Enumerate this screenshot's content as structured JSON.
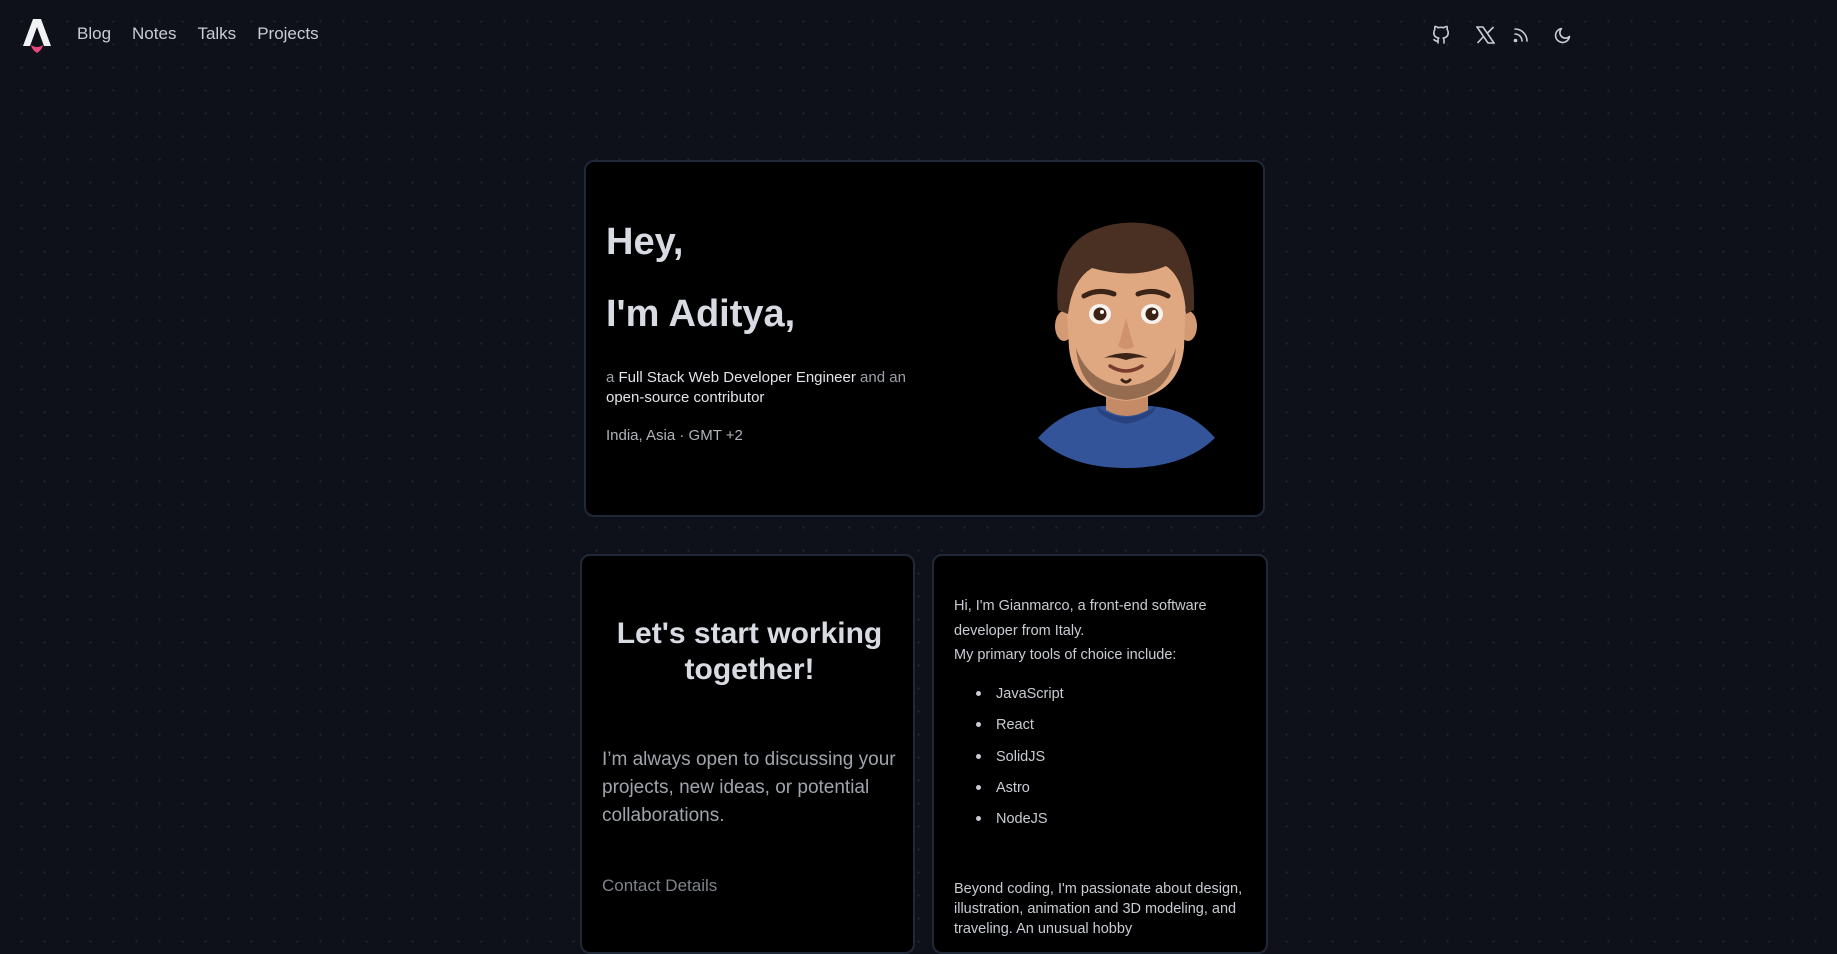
{
  "nav": {
    "links": [
      "Blog",
      "Notes",
      "Talks",
      "Projects"
    ],
    "icons": [
      "github-icon",
      "x-icon",
      "rss-icon",
      "moon-icon"
    ]
  },
  "hero": {
    "greeting": "Hey,",
    "name": "I'm Aditya,",
    "tagline_prefix": "a ",
    "tagline_role": "Full Stack Web Developer Engineer",
    "tagline_mid": " and an ",
    "tagline_contrib": "open-source contributor",
    "location": "India, Asia · GMT +2"
  },
  "work": {
    "title": "Let's start working together!",
    "description": "I’m always open to discussing your projects, new ideas, or potential collaborations.",
    "contact_label": "Contact Details"
  },
  "about": {
    "intro_line1": "Hi, I'm Gianmarco, a front-end software developer from Italy.",
    "intro_line2": "My primary tools of choice include:",
    "tools": [
      "JavaScript",
      "React",
      "SolidJS",
      "Astro",
      "NodeJS"
    ],
    "more": "Beyond coding, I'm passionate about design, illustration, animation and 3D modeling, and traveling. An unusual hobby"
  },
  "colors": {
    "background": "#0e111a",
    "card": "#000000",
    "border": "#1f2937",
    "logo_accent": "#e8457c"
  }
}
